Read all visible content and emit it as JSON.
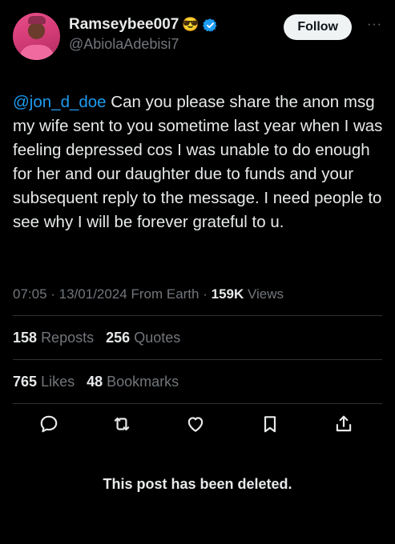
{
  "header": {
    "display_name": "Ramseybee007",
    "emoji": "😎",
    "handle": "@AbiolaAdebisi7",
    "follow_label": "Follow",
    "more_label": "···"
  },
  "tweet": {
    "mention": "@jon_d_doe",
    "text": " Can you please share the anon msg my wife sent to you sometime last year when I was feeling depressed cos I was unable to do enough for her and our daughter due to funds and your subsequent reply to the message. I need people to see why I will be forever grateful to u."
  },
  "meta": {
    "time": "07:05",
    "sep1": " · ",
    "date": "13/01/2024",
    "source": " From Earth",
    "sep2": " · ",
    "views_count": "159K",
    "views_label": " Views"
  },
  "stats": {
    "reposts_count": "158",
    "reposts_label": "Reposts",
    "quotes_count": "256",
    "quotes_label": "Quotes",
    "likes_count": "765",
    "likes_label": "Likes",
    "bookmarks_count": "48",
    "bookmarks_label": "Bookmarks"
  },
  "icons": [
    "reply-icon",
    "repost-icon",
    "like-icon",
    "bookmark-icon",
    "share-icon"
  ],
  "status_message": "This post has been deleted.",
  "colors": {
    "background": "#000000",
    "text": "#e7e9ea",
    "muted": "#71767b",
    "link": "#1d9bf0",
    "verified": "#1d9bf0"
  }
}
